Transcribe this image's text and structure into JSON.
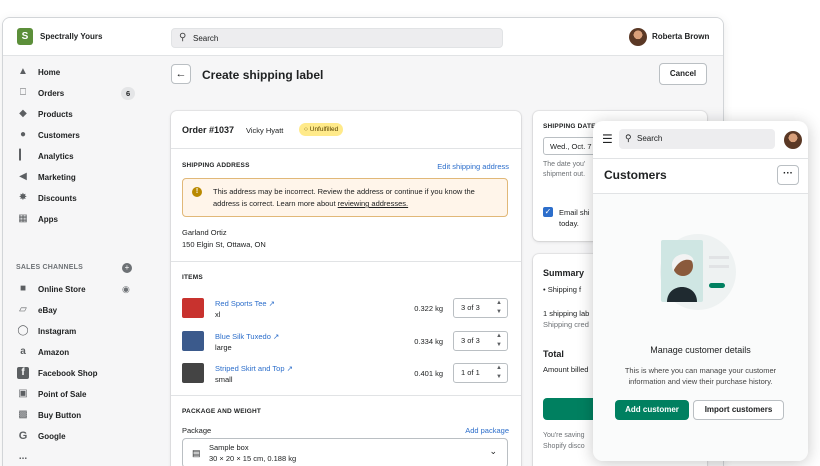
{
  "topbar": {
    "store_name": "Spectrally Yours",
    "search_placeholder": "Search",
    "user_name": "Roberta Brown"
  },
  "sidebar": {
    "items": [
      {
        "label": "Home",
        "icon": "home-icon"
      },
      {
        "label": "Orders",
        "icon": "orders-icon",
        "badge": "6"
      },
      {
        "label": "Products",
        "icon": "tag-icon"
      },
      {
        "label": "Customers",
        "icon": "person-icon"
      },
      {
        "label": "Analytics",
        "icon": "bar-chart-icon"
      },
      {
        "label": "Marketing",
        "icon": "megaphone-icon"
      },
      {
        "label": "Discounts",
        "icon": "discount-icon"
      },
      {
        "label": "Apps",
        "icon": "apps-icon"
      }
    ],
    "sales_channels_title": "SALES CHANNELS",
    "channels": [
      {
        "label": "Online Store",
        "icon": "store-icon"
      },
      {
        "label": "eBay",
        "icon": "bag-icon"
      },
      {
        "label": "Instagram",
        "icon": "instagram-icon"
      },
      {
        "label": "Amazon",
        "icon": "amazon-icon"
      },
      {
        "label": "Facebook Shop",
        "icon": "facebook-icon"
      },
      {
        "label": "Point of Sale",
        "icon": "pos-icon"
      },
      {
        "label": "Buy Button",
        "icon": "buy-button-icon"
      },
      {
        "label": "Google",
        "icon": "google-icon"
      }
    ],
    "more": "..."
  },
  "page": {
    "title": "Create shipping label",
    "cancel": "Cancel",
    "order_title": "Order #1037",
    "customer": "Vicky Hyatt",
    "status": "Unfulfilled",
    "shipping_address_title": "SHIPPING ADDRESS",
    "edit_address": "Edit shipping address",
    "warning_text": "This address may be incorrect. Review the address or continue if you know the address is correct. Learn more about ",
    "warning_link": "reviewing addresses.",
    "address_name": "Garland Ortiz",
    "address_line": "150 Elgin St, Ottawa, ON",
    "items_title": "ITEMS",
    "items": [
      {
        "name": "Red Sports Tee",
        "variant": "xl",
        "weight": "0.322 kg",
        "qty": "3  of 3",
        "color": "#c8322e"
      },
      {
        "name": "Blue Silk Tuxedo",
        "variant": "large",
        "weight": "0.334 kg",
        "qty": "3  of 3",
        "color": "#3b5a8c"
      },
      {
        "name": "Striped Skirt and Top",
        "variant": "small",
        "weight": "0.401 kg",
        "qty": "1  of 1",
        "color": "#444444"
      }
    ],
    "package_title": "PACKAGE AND WEIGHT",
    "package_label": "Package",
    "add_package": "Add package",
    "package_name": "Sample box",
    "package_dims": "30 × 20 × 15 cm, 0.188 kg"
  },
  "right": {
    "shipping_date_title": "SHIPPING DATE",
    "date_value": "Wed., Oct. 7",
    "date_help_1": "The date you'",
    "date_help_2": "shipment out.",
    "email_label_1": "Email shi",
    "email_label_2": "today.",
    "summary_title": "Summary",
    "summary_bullet": "Shipping f",
    "summary_line1": "1 shipping lab",
    "summary_line2": "Shipping cred",
    "total_title": "Total",
    "total_line": "Amount billed",
    "buy_button": "Bu",
    "saving_1": "You're saving",
    "saving_2": "Shopify disco"
  },
  "mobile": {
    "search_placeholder": "Search",
    "title": "Customers",
    "more": "···",
    "empty_title": "Manage customer details",
    "empty_text": "This is where you can manage your customer information and view their purchase history.",
    "add_customer": "Add customer",
    "import_customers": "Import customers"
  },
  "colors": {
    "brand_green": "#008060",
    "link_blue": "#2c6ecb",
    "warning_bg": "#fff5ea",
    "status_yellow": "#ffea8a"
  }
}
